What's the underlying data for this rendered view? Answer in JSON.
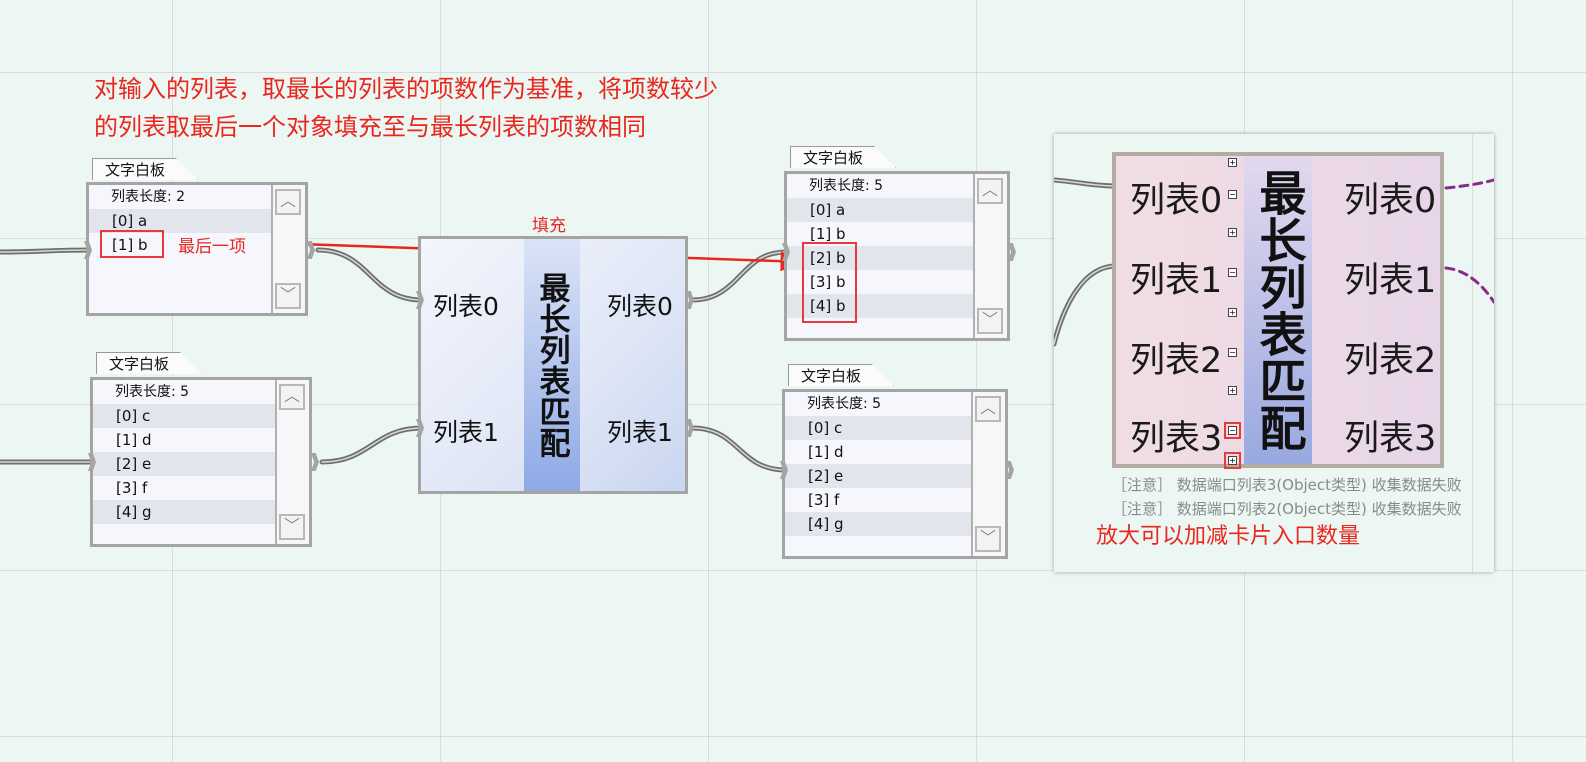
{
  "annotation": {
    "line1": "对输入的列表，取最长的列表的项数作为基准，将项数较少",
    "line2": "的列表取最后一个对象填充至与最长列表的项数相同",
    "last_item_label": "最后一项",
    "fill_label": "填充",
    "zoom_hint": "放大可以加减卡片入口数量"
  },
  "boards": [
    {
      "tab": "文字白板",
      "header": "列表长度: 2",
      "items": [
        "[0] a",
        "[1] b"
      ]
    },
    {
      "tab": "文字白板",
      "header": "列表长度: 5",
      "items": [
        "[0] c",
        "[1] d",
        "[2] e",
        "[3] f",
        "[4] g"
      ]
    },
    {
      "tab": "文字白板",
      "header": "列表长度: 5",
      "items": [
        "[0] a",
        "[1] b",
        "[2] b",
        "[3] b",
        "[4] b"
      ]
    },
    {
      "tab": "文字白板",
      "header": "列表长度: 5",
      "items": [
        "[0] c",
        "[1] d",
        "[2] e",
        "[3] f",
        "[4] g"
      ]
    }
  ],
  "match_node": {
    "title": "最长列表匹配",
    "inputs": [
      "列表0",
      "列表1"
    ],
    "outputs": [
      "列表0",
      "列表1"
    ]
  },
  "zoomed_node": {
    "title": "最长列表匹配",
    "inputs": [
      "列表0",
      "列表1",
      "列表2",
      "列表3"
    ],
    "outputs": [
      "列表0",
      "列表1",
      "列表2",
      "列表3"
    ],
    "warnings": [
      "［注意］ 数据端口列表3(Object类型) 收集数据失败",
      "［注意］ 数据端口列表2(Object类型) 收集数据失败"
    ]
  }
}
